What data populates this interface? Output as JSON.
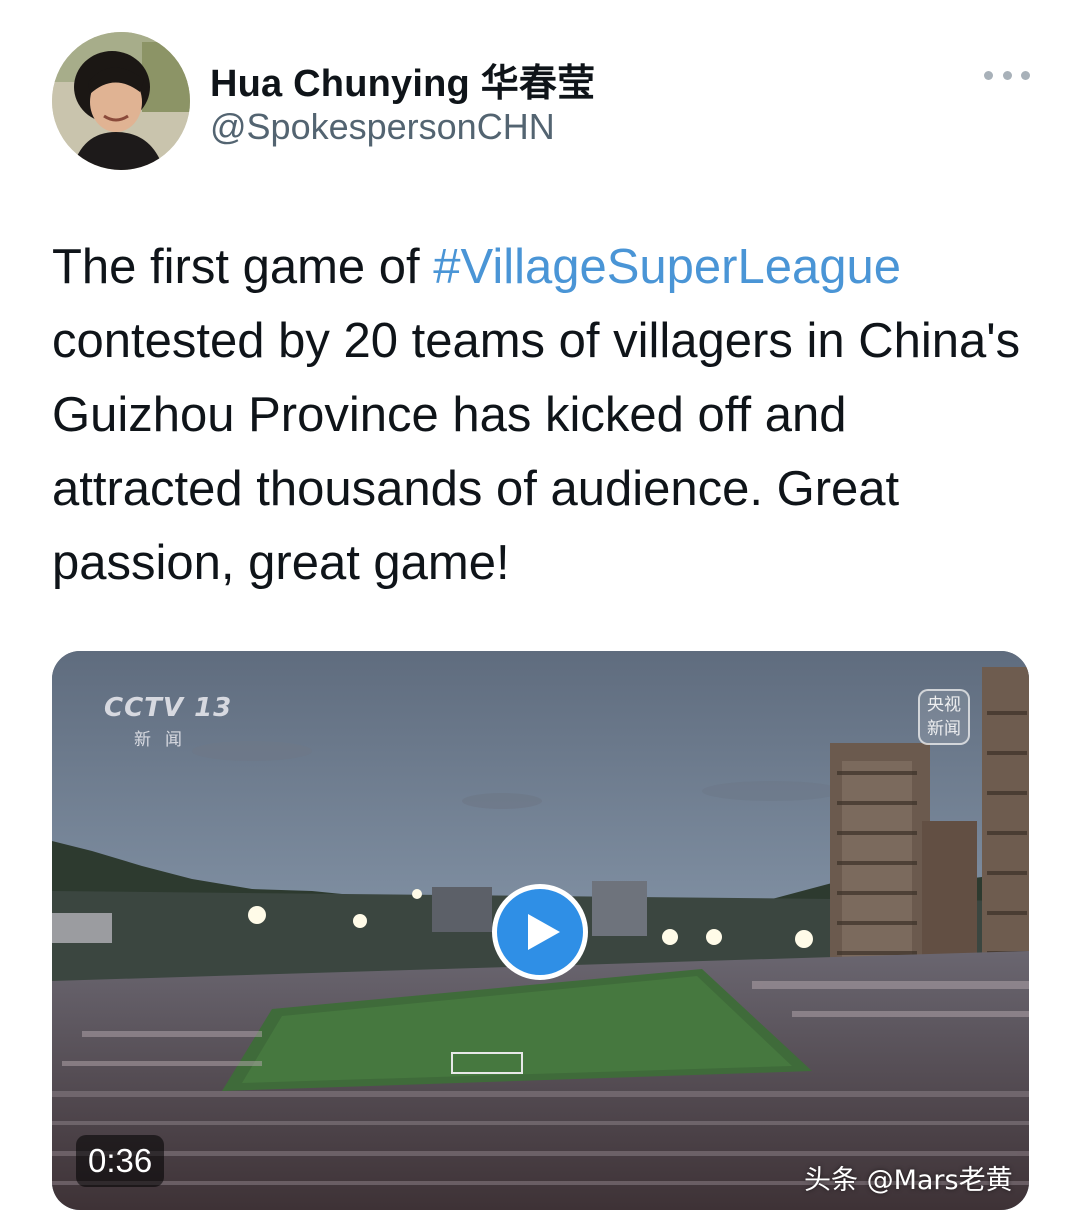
{
  "author": {
    "display_name": "Hua Chunying 华春莹",
    "handle": "@SpokespersonCHN",
    "avatar_icon": "profile-photo"
  },
  "more_menu": {
    "icon": "more-dots-icon"
  },
  "tweet": {
    "text_before": "The first game of ",
    "hashtag": "#VillageSuperLeague",
    "text_after": " contested by 20 teams of villagers in China's Guizhou Province has kicked off and attracted thousands of audience. Great passion, great game!"
  },
  "media": {
    "type": "video",
    "broadcaster_logo": "CCTV 13",
    "broadcaster_sub": "新闻",
    "corner_bug": "央视新闻",
    "duration": "0:36",
    "play_icon": "play-icon"
  },
  "watermark": "头条 @Mars老黄",
  "colors": {
    "hashtag": "#4a95d6",
    "play_button": "#2f8fe6",
    "handle": "#536471"
  }
}
